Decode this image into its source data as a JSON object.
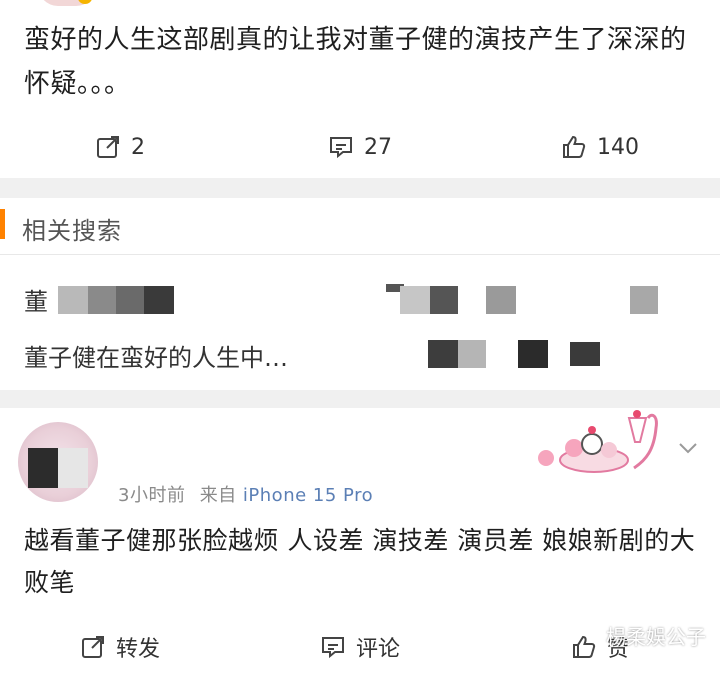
{
  "post": {
    "text": "蛮好的人生这部剧真的让我对董子健的演技产生了深深的怀疑。。。",
    "actions": {
      "repost_count": "2",
      "comment_count": "27",
      "like_count": "140"
    }
  },
  "related": {
    "title": "相关搜索",
    "line1": "董",
    "line2": "董子健在蛮好的人生中…"
  },
  "comment": {
    "time": "3小时前",
    "source_prefix": "来自",
    "source": "iPhone 15 Pro",
    "text": "越看董子健那张脸越烦 人设差 演技差 演员差  娘娘新剧的大败笔",
    "actions": {
      "repost_label": "转发",
      "comment_label": "评论",
      "like_label": "赞"
    }
  },
  "watermark": "楊柔娛公子",
  "colors": {
    "accent": "#ff8200",
    "source_link": "#5b7fb5",
    "divider": "#f0f0f0"
  }
}
